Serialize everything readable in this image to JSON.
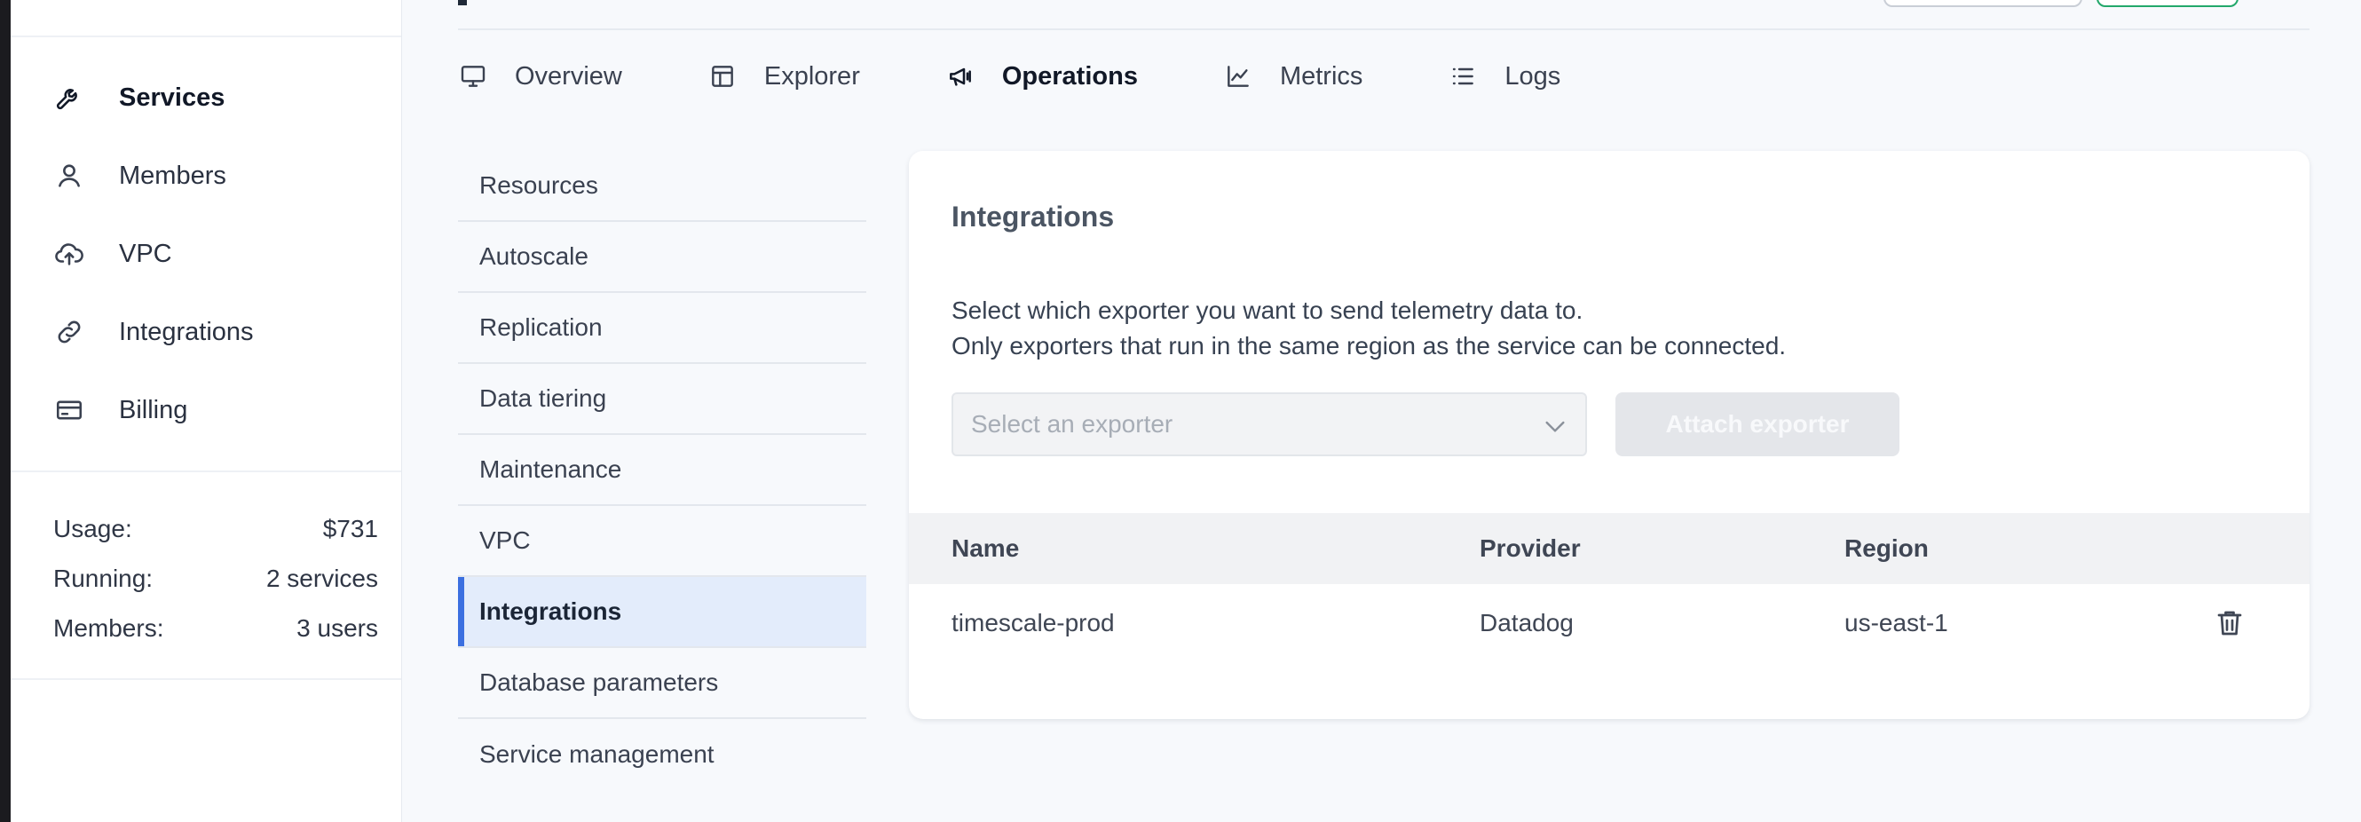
{
  "sidebar": {
    "items": [
      {
        "label": "Services",
        "icon": "wrench-icon",
        "active": true
      },
      {
        "label": "Members",
        "icon": "user-icon",
        "active": false
      },
      {
        "label": "VPC",
        "icon": "cloud-upload-icon",
        "active": false
      },
      {
        "label": "Integrations",
        "icon": "link-icon",
        "active": false
      },
      {
        "label": "Billing",
        "icon": "credit-card-icon",
        "active": false
      }
    ],
    "stats": [
      {
        "label": "Usage:",
        "value": "$731"
      },
      {
        "label": "Running:",
        "value": "2 services"
      },
      {
        "label": "Members:",
        "value": "3 users"
      }
    ]
  },
  "tabs": [
    {
      "label": "Overview",
      "icon": "monitor-icon"
    },
    {
      "label": "Explorer",
      "icon": "layout-icon"
    },
    {
      "label": "Operations",
      "icon": "megaphone-icon",
      "active": true
    },
    {
      "label": "Metrics",
      "icon": "line-chart-icon"
    },
    {
      "label": "Logs",
      "icon": "list-icon"
    }
  ],
  "submenu": [
    "Resources",
    "Autoscale",
    "Replication",
    "Data tiering",
    "Maintenance",
    "VPC",
    "Integrations",
    "Database parameters",
    "Service management"
  ],
  "submenu_active": "Integrations",
  "card": {
    "title": "Integrations",
    "desc_line1": "Select which exporter you want to send telemetry data to.",
    "desc_line2": "Only exporters that run in the same region as the service can be connected.",
    "select_placeholder": "Select an exporter",
    "attach_label": "Attach exporter",
    "table": {
      "headers": {
        "name": "Name",
        "provider": "Provider",
        "region": "Region"
      },
      "rows": [
        {
          "name": "timescale-prod",
          "provider": "Datadog",
          "region": "us-east-1"
        }
      ]
    }
  },
  "colors": {
    "accent": "#3b6fe0",
    "active_bg": "#e3ecfb",
    "success": "#23a86b"
  }
}
